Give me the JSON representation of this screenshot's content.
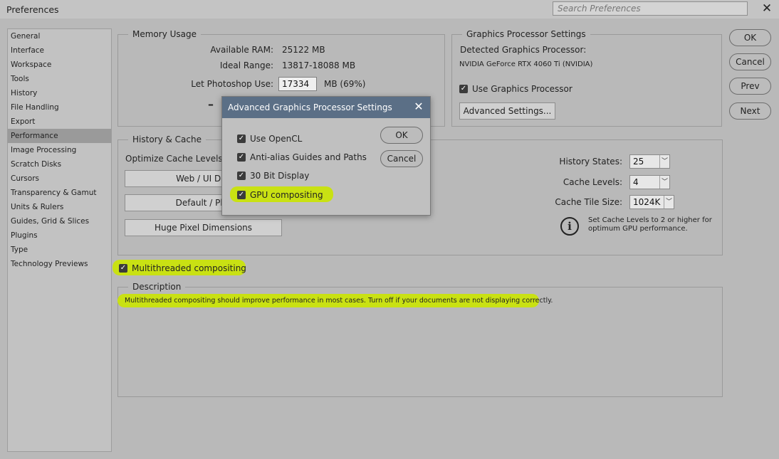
{
  "window": {
    "title": "Preferences",
    "search_placeholder": "Search Preferences",
    "close_glyph": "✕"
  },
  "sidebar": {
    "items": [
      {
        "label": "General"
      },
      {
        "label": "Interface"
      },
      {
        "label": "Workspace"
      },
      {
        "label": "Tools"
      },
      {
        "label": "History"
      },
      {
        "label": "File Handling"
      },
      {
        "label": "Export"
      },
      {
        "label": "Performance",
        "active": true
      },
      {
        "label": "Image Processing"
      },
      {
        "label": "Scratch Disks"
      },
      {
        "label": "Cursors"
      },
      {
        "label": "Transparency & Gamut"
      },
      {
        "label": "Units & Rulers"
      },
      {
        "label": "Guides, Grid & Slices"
      },
      {
        "label": "Plugins"
      },
      {
        "label": "Type"
      },
      {
        "label": "Technology Previews"
      }
    ]
  },
  "memory": {
    "legend": "Memory Usage",
    "available_label": "Available RAM:",
    "available_value": "25122 MB",
    "ideal_label": "Ideal Range:",
    "ideal_value": "13817-18088 MB",
    "let_label": "Let Photoshop Use:",
    "let_value": "17334",
    "let_unit": "MB (69%)",
    "slider_minus": "–"
  },
  "gpu": {
    "legend": "Graphics Processor Settings",
    "detected_label": "Detected Graphics Processor:",
    "gpu_name": "NVIDIA GeForce RTX 4060 Ti (NVIDIA)",
    "use_gpu_label": "Use Graphics Processor",
    "advanced_button": "Advanced Settings..."
  },
  "history_cache": {
    "legend": "History & Cache",
    "optimize_label": "Optimize Cache Levels a",
    "web_button": "Web / UI Des",
    "default_button": "Default / Pho",
    "huge_button": "Huge Pixel Dimensions",
    "history_states_label": "History States:",
    "history_states_value": "25",
    "cache_levels_label": "Cache Levels:",
    "cache_levels_value": "4",
    "cache_tile_label": "Cache Tile Size:",
    "cache_tile_value": "1024K",
    "tip_line1": "Set Cache Levels to 2 or higher for",
    "tip_line2": "optimum GPU performance.",
    "info_glyph": "i"
  },
  "multithreaded_label": "Multithreaded compositing",
  "description": {
    "legend": "Description",
    "text": "Multithreaded compositing should improve performance in most cases. Turn off if your documents are not displaying correctly."
  },
  "buttons": {
    "ok": "OK",
    "cancel": "Cancel",
    "prev": "Prev",
    "next": "Next"
  },
  "modal": {
    "title": "Advanced Graphics Processor Settings",
    "close_glyph": "✕",
    "options": [
      {
        "label": "Use OpenCL",
        "checked": true
      },
      {
        "label": "Anti-alias Guides and Paths",
        "checked": true
      },
      {
        "label": "30 Bit Display",
        "checked": true
      },
      {
        "label": "GPU compositing",
        "checked": true
      }
    ],
    "ok": "OK",
    "cancel": "Cancel"
  },
  "checkmark_glyph": "✓",
  "colors": {
    "highlight": "#c9e113",
    "modal_titlebar": "#5b6f86",
    "panel_bg": "#b9b9b9"
  }
}
